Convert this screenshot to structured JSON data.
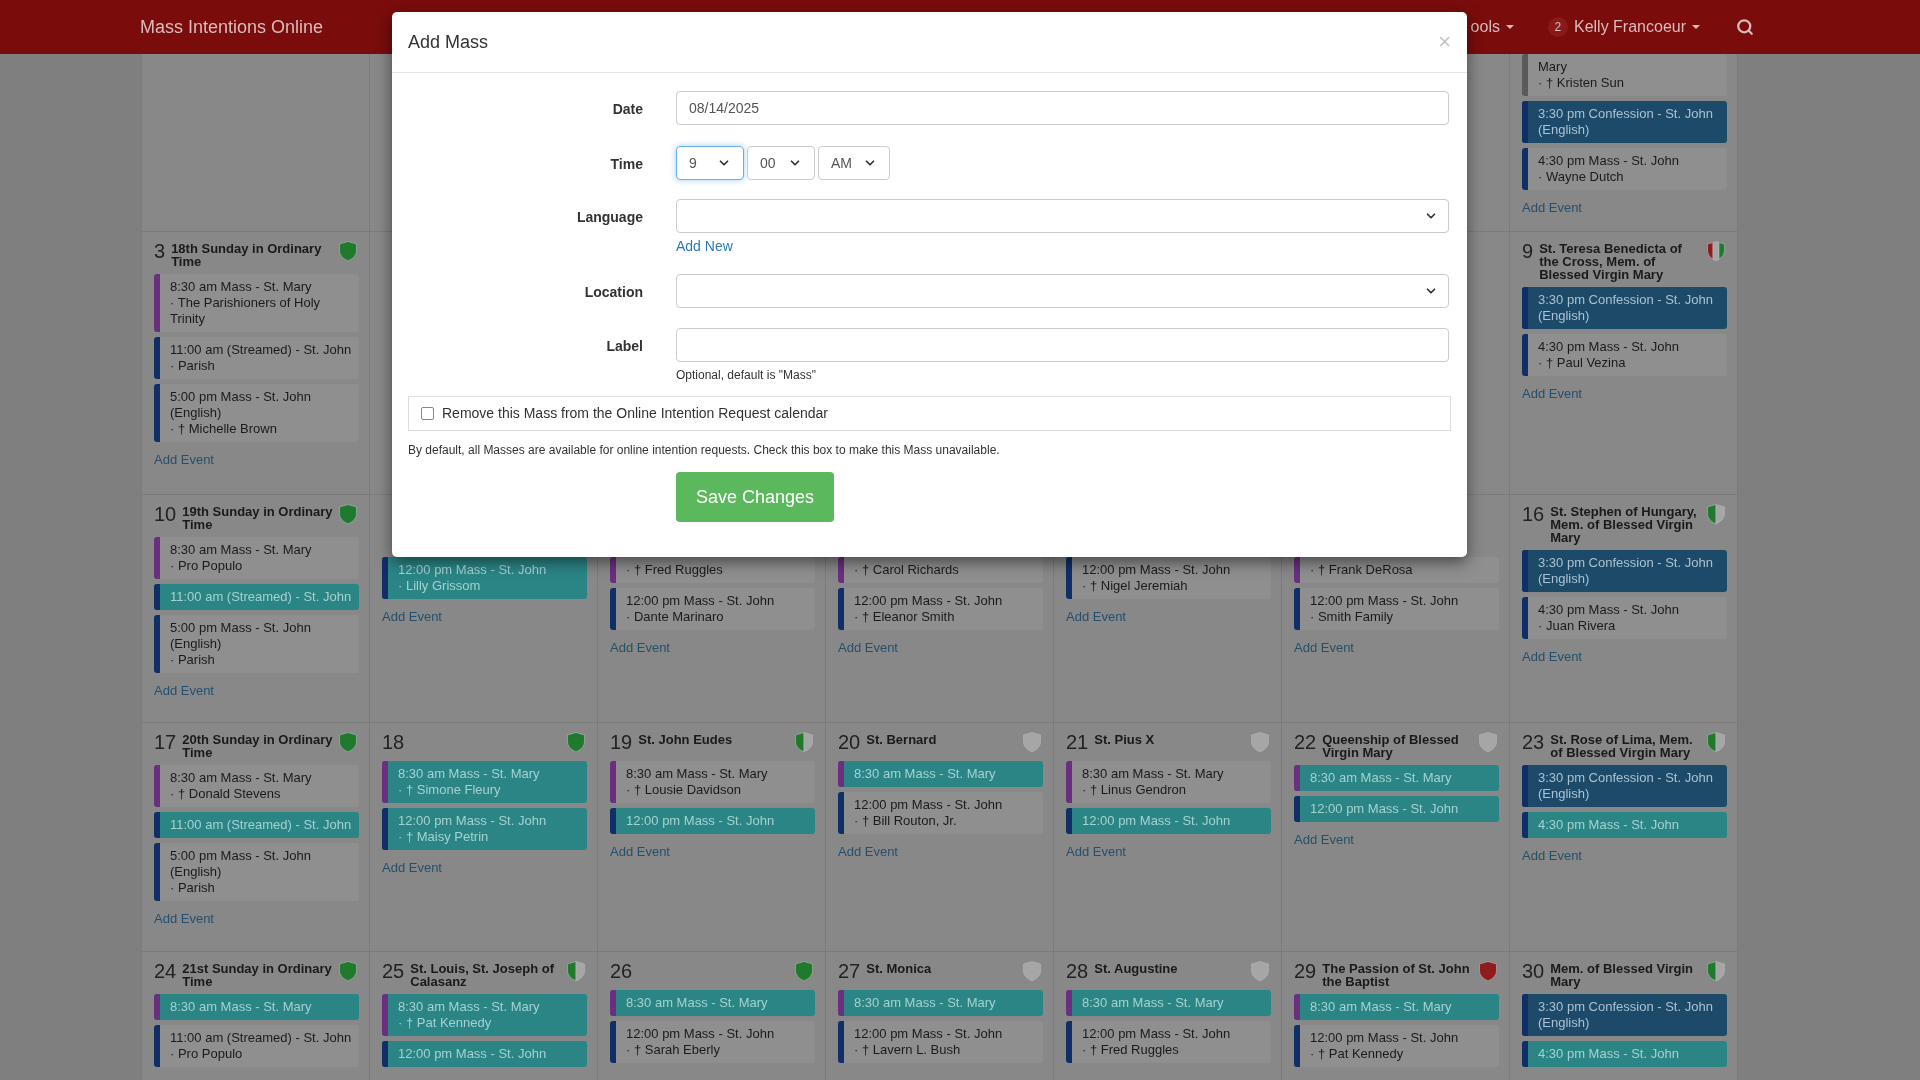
{
  "navbar": {
    "brand": "Mass Intentions Online",
    "menu": "ools",
    "badge": "2",
    "user": "Kelly Francoeur"
  },
  "weeks": [
    {
      "days": [
        {
          "kind": "empty"
        },
        {
          "kind": "empty"
        },
        {
          "kind": "empty"
        },
        {
          "kind": "empty"
        },
        {
          "kind": "empty"
        },
        {
          "kind": "empty"
        },
        {
          "kind": "scrolled",
          "events": [
            {
              "kind": "intention",
              "color": "#5a5a5a",
              "title": "Mary",
              "intention": "· † Kristen Sun"
            },
            {
              "kind": "confession",
              "color": "#0f2f66",
              "title": "3:30 pm Confession - St. John (English)"
            },
            {
              "kind": "intention",
              "color": "#0f2f66",
              "title": "4:30 pm Mass - St. John",
              "intention": "· Wayne Dutch"
            }
          ],
          "add_event": "Add Event"
        }
      ]
    },
    {
      "days": [
        {
          "day": "3",
          "title": "18th Sunday in Ordinary Time",
          "vestments": [
            {
              "color": "#1f7a2e"
            }
          ],
          "events": [
            {
              "kind": "intention",
              "color": "#6a2f7e",
              "title": "8:30 am Mass - St. Mary",
              "intention": "· The Parishioners of Holy Trinity"
            },
            {
              "kind": "intention",
              "color": "#0f2f66",
              "title": "11:00 am (Streamed) - St. John",
              "intention": "· Parish"
            },
            {
              "kind": "intention",
              "color": "#0f2f66",
              "title": "5:00 pm Mass - St. John (English)",
              "intention": "· † Michelle Brown"
            }
          ],
          "add_event": "Add Event"
        },
        {
          "kind": "empty"
        },
        {
          "kind": "empty"
        },
        {
          "kind": "empty"
        },
        {
          "kind": "empty"
        },
        {
          "kind": "empty"
        },
        {
          "day": "9",
          "title": "St. Teresa Benedicta of the Cross, Mem. of Blessed Virgin Mary",
          "vestments": [
            {
              "color": "#8f1c1c"
            },
            {
              "color": "#a6a6a6"
            },
            {
              "color": "#1f7a2e"
            }
          ],
          "events": [
            {
              "kind": "confession",
              "color": "#0f2f66",
              "title": "3:30 pm Confession - St. John (English)"
            },
            {
              "kind": "intention",
              "color": "#0f2f66",
              "title": "4:30 pm Mass - St. John",
              "intention": "· † Paul Vezina"
            }
          ],
          "add_event": "Add Event"
        }
      ]
    },
    {
      "days": [
        {
          "day": "10",
          "title": "19th Sunday in Ordinary Time",
          "vestments": [
            {
              "color": "#1f7a2e"
            }
          ],
          "events": [
            {
              "kind": "intention",
              "color": "#6a2f7e",
              "title": "8:30 am Mass - St. Mary",
              "intention": "· Pro Populo"
            },
            {
              "kind": "open",
              "color": "#0f2f66",
              "title": "11:00 am (Streamed) - St. John"
            },
            {
              "kind": "intention",
              "color": "#0f2f66",
              "title": "5:00 pm Mass - St. John (English)",
              "intention": "· Parish"
            }
          ],
          "add_event": "Add Event"
        },
        {
          "kind": "covered",
          "events": [
            {
              "kind": "open",
              "color": "#0f2f66",
              "title": "12:00 pm Mass - St. John",
              "intention": "· Lilly Grissom"
            }
          ],
          "add_event": "Add Event"
        },
        {
          "kind": "covered",
          "events": [
            {
              "kind": "intention",
              "color": "#6a2f7e",
              "intention": "· † Fred Ruggles"
            },
            {
              "kind": "intention",
              "color": "#0f2f66",
              "title": "12:00 pm Mass - St. John",
              "intention": "· Dante Marinaro"
            }
          ],
          "add_event": "Add Event"
        },
        {
          "kind": "covered",
          "events": [
            {
              "kind": "intention",
              "color": "#6a2f7e",
              "intention": "· † Carol Richards"
            },
            {
              "kind": "intention",
              "color": "#0f2f66",
              "title": "12:00 pm Mass - St. John",
              "intention": "· † Eleanor Smith"
            }
          ],
          "add_event": "Add Event"
        },
        {
          "kind": "covered",
          "events": [
            {
              "kind": "intention",
              "color": "#0f2f66",
              "title": "12:00 pm Mass - St. John",
              "intention": "· † Nigel Jeremiah"
            }
          ],
          "add_event": "Add Event"
        },
        {
          "kind": "covered",
          "events": [
            {
              "kind": "intention",
              "color": "#6a2f7e",
              "intention": "· † Frank DeRosa"
            },
            {
              "kind": "intention",
              "color": "#0f2f66",
              "title": "12:00 pm Mass - St. John",
              "intention": "· Smith Family"
            }
          ],
          "add_event": "Add Event"
        },
        {
          "day": "16",
          "title": "St. Stephen of Hungary, Mem. of Blessed Virgin Mary",
          "vestments": [
            {
              "color": "#1f7a2e"
            },
            {
              "color": "#a6a6a6"
            }
          ],
          "events": [
            {
              "kind": "confession",
              "color": "#0f2f66",
              "title": "3:30 pm Confession - St. John (English)"
            },
            {
              "kind": "intention",
              "color": "#0f2f66",
              "title": "4:30 pm Mass - St. John",
              "intention": "· Juan Rivera"
            }
          ],
          "add_event": "Add Event"
        }
      ]
    },
    {
      "days": [
        {
          "day": "17",
          "title": "20th Sunday in Ordinary Time",
          "vestments": [
            {
              "color": "#1f7a2e"
            }
          ],
          "events": [
            {
              "kind": "intention",
              "color": "#6a2f7e",
              "title": "8:30 am Mass - St. Mary",
              "intention": "· † Donald Stevens"
            },
            {
              "kind": "open",
              "color": "#0f2f66",
              "title": "11:00 am (Streamed) - St. John"
            },
            {
              "kind": "intention",
              "color": "#0f2f66",
              "title": "5:00 pm Mass - St. John (English)",
              "intention": "· Parish"
            }
          ],
          "add_event": "Add Event"
        },
        {
          "day": "18",
          "vestments": [
            {
              "color": "#1f7a2e"
            }
          ],
          "events": [
            {
              "kind": "open",
              "color": "#6a2f7e",
              "title": "8:30 am Mass - St. Mary",
              "intention": "· † Simone Fleury"
            },
            {
              "kind": "open",
              "color": "#0f2f66",
              "title": "12:00 pm Mass - St. John",
              "intention": "· † Maisy Petrin"
            }
          ],
          "add_event": "Add Event"
        },
        {
          "day": "19",
          "title": "St. John Eudes",
          "vestments": [
            {
              "color": "#1f7a2e"
            },
            {
              "color": "#a6a6a6"
            }
          ],
          "events": [
            {
              "kind": "intention",
              "color": "#6a2f7e",
              "title": "8:30 am Mass - St. Mary",
              "intention": "· † Lousie Davidson"
            },
            {
              "kind": "open",
              "color": "#0f2f66",
              "title": "12:00 pm Mass - St. John"
            }
          ],
          "add_event": "Add Event"
        },
        {
          "day": "20",
          "title": "St. Bernard",
          "vestments": [
            {
              "color": "#a6a6a6"
            }
          ],
          "events": [
            {
              "kind": "open",
              "color": "#6a2f7e",
              "title": "8:30 am Mass - St. Mary"
            },
            {
              "kind": "intention",
              "color": "#0f2f66",
              "title": "12:00 pm Mass - St. John",
              "intention": "· † Bill Routon, Jr."
            }
          ],
          "add_event": "Add Event"
        },
        {
          "day": "21",
          "title": "St. Pius X",
          "vestments": [
            {
              "color": "#a6a6a6"
            }
          ],
          "events": [
            {
              "kind": "intention",
              "color": "#6a2f7e",
              "title": "8:30 am Mass - St. Mary",
              "intention": "· † Linus Gendron"
            },
            {
              "kind": "open",
              "color": "#0f2f66",
              "title": "12:00 pm Mass - St. John"
            }
          ],
          "add_event": "Add Event"
        },
        {
          "day": "22",
          "title": "Queenship of Blessed Virgin Mary",
          "vestments": [
            {
              "color": "#a6a6a6"
            }
          ],
          "events": [
            {
              "kind": "open",
              "color": "#6a2f7e",
              "title": "8:30 am Mass - St. Mary"
            },
            {
              "kind": "open",
              "color": "#0f2f66",
              "title": "12:00 pm Mass - St. John"
            }
          ],
          "add_event": "Add Event"
        },
        {
          "day": "23",
          "title": "St. Rose of Lima, Mem. of Blessed Virgin Mary",
          "vestments": [
            {
              "color": "#1f7a2e"
            },
            {
              "color": "#a6a6a6"
            }
          ],
          "events": [
            {
              "kind": "confession",
              "color": "#0f2f66",
              "title": "3:30 pm Confession - St. John (English)"
            },
            {
              "kind": "open",
              "color": "#0f2f66",
              "title": "4:30 pm Mass - St. John"
            }
          ],
          "add_event": "Add Event"
        }
      ]
    },
    {
      "days": [
        {
          "day": "24",
          "title": "21st Sunday in Ordinary Time",
          "vestments": [
            {
              "color": "#1f7a2e"
            }
          ],
          "events": [
            {
              "kind": "open",
              "color": "#6a2f7e",
              "title": "8:30 am Mass - St. Mary"
            },
            {
              "kind": "intention",
              "color": "#0f2f66",
              "title": "11:00 am (Streamed) - St. John",
              "intention": "· Pro Populo"
            }
          ]
        },
        {
          "day": "25",
          "title": "St. Louis, St. Joseph of Calasanz",
          "vestments": [
            {
              "color": "#1f7a2e"
            },
            {
              "color": "#a6a6a6"
            }
          ],
          "events": [
            {
              "kind": "open",
              "color": "#6a2f7e",
              "title": "8:30 am Mass - St. Mary",
              "intention": "· † Pat Kennedy"
            },
            {
              "kind": "open",
              "color": "#0f2f66",
              "title": "12:00 pm Mass - St. John"
            }
          ]
        },
        {
          "day": "26",
          "vestments": [
            {
              "color": "#1f7a2e"
            }
          ],
          "events": [
            {
              "kind": "open",
              "color": "#6a2f7e",
              "title": "8:30 am Mass - St. Mary"
            },
            {
              "kind": "intention",
              "color": "#0f2f66",
              "title": "12:00 pm Mass - St. John",
              "intention": "· † Sarah Eberly"
            }
          ]
        },
        {
          "day": "27",
          "title": "St. Monica",
          "vestments": [
            {
              "color": "#a6a6a6"
            }
          ],
          "events": [
            {
              "kind": "open",
              "color": "#6a2f7e",
              "title": "8:30 am Mass - St. Mary"
            },
            {
              "kind": "intention",
              "color": "#0f2f66",
              "title": "12:00 pm Mass - St. John",
              "intention": "· † Lavern L. Bush"
            }
          ]
        },
        {
          "day": "28",
          "title": "St. Augustine",
          "vestments": [
            {
              "color": "#a6a6a6"
            }
          ],
          "events": [
            {
              "kind": "open",
              "color": "#6a2f7e",
              "title": "8:30 am Mass - St. Mary"
            },
            {
              "kind": "intention",
              "color": "#0f2f66",
              "title": "12:00 pm Mass - St. John",
              "intention": "· † Fred Ruggles"
            }
          ]
        },
        {
          "day": "29",
          "title": "The Passion of St. John the Baptist",
          "vestments": [
            {
              "color": "#8f1c1c"
            }
          ],
          "events": [
            {
              "kind": "open",
              "color": "#6a2f7e",
              "title": "8:30 am Mass - St. Mary"
            },
            {
              "kind": "intention",
              "color": "#0f2f66",
              "title": "12:00 pm Mass - St. John",
              "intention": "· † Pat Kennedy"
            }
          ]
        },
        {
          "day": "30",
          "title": "Mem. of Blessed Virgin Mary",
          "vestments": [
            {
              "color": "#1f7a2e"
            },
            {
              "color": "#a6a6a6"
            }
          ],
          "events": [
            {
              "kind": "confession",
              "color": "#0f2f66",
              "title": "3:30 pm Confession - St. John (English)"
            },
            {
              "kind": "open",
              "color": "#0f2f66",
              "title": "4:30 pm Mass - St. John"
            }
          ]
        }
      ]
    }
  ],
  "modal": {
    "title": "Add Mass",
    "close": "×",
    "date": {
      "label": "Date",
      "value": "08/14/2025"
    },
    "time": {
      "label": "Time",
      "selects": [
        {
          "value": "9",
          "focused": true
        },
        {
          "value": "00",
          "focused": false
        },
        {
          "value": "AM",
          "focused": false
        }
      ]
    },
    "language": {
      "label": "Language",
      "link": "Add New"
    },
    "location": {
      "label": "Location"
    },
    "label_field": {
      "label": "Label",
      "help": "Optional, default is \"Mass\""
    },
    "remove": {
      "label": "Remove this Mass from the Online Intention Request calendar",
      "checked": false
    },
    "note": "By default, all Masses are available for online intention requests. Check this box to make this Mass unavailable.",
    "save": "Save Changes"
  }
}
